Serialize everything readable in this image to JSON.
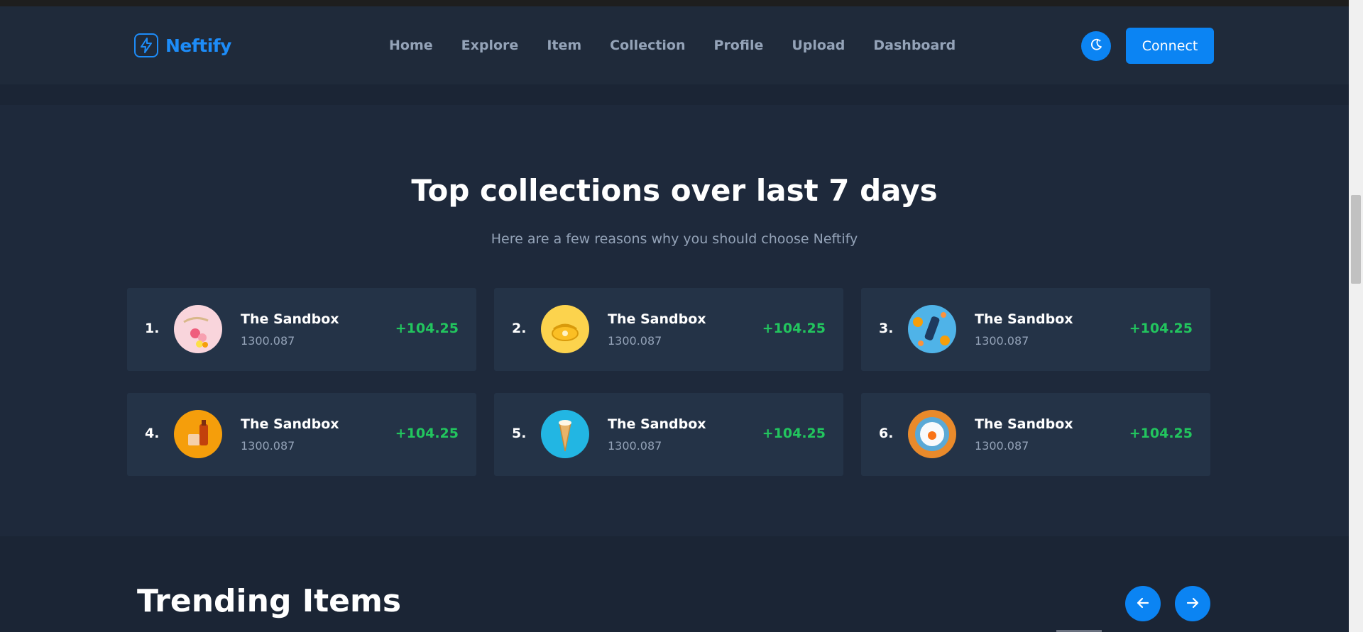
{
  "brand": {
    "name": "Neftify",
    "logo_icon": "bolt-icon",
    "accent": "#1d8cf8"
  },
  "nav": {
    "links": [
      "Home",
      "Explore",
      "Item",
      "Collection",
      "Profile",
      "Upload",
      "Dashboard"
    ]
  },
  "header": {
    "theme_icon": "moon-icon",
    "connect_label": "Connect"
  },
  "top_collections": {
    "title": "Top collections over last 7 days",
    "subtitle": "Here are a few reasons why you should choose Neftify",
    "items": [
      {
        "rank": "1.",
        "name": "The Sandbox",
        "amount": "1300.087",
        "change": "+104.25"
      },
      {
        "rank": "2.",
        "name": "The Sandbox",
        "amount": "1300.087",
        "change": "+104.25"
      },
      {
        "rank": "3.",
        "name": "The Sandbox",
        "amount": "1300.087",
        "change": "+104.25"
      },
      {
        "rank": "4.",
        "name": "The Sandbox",
        "amount": "1300.087",
        "change": "+104.25"
      },
      {
        "rank": "5.",
        "name": "The Sandbox",
        "amount": "1300.087",
        "change": "+104.25"
      },
      {
        "rank": "6.",
        "name": "The Sandbox",
        "amount": "1300.087",
        "change": "+104.25"
      }
    ]
  },
  "trending": {
    "title": "Trending Items",
    "prev_icon": "arrow-left-icon",
    "next_icon": "arrow-right-icon"
  },
  "colors": {
    "background": "#1e293b",
    "card": "#243347",
    "positive": "#22c55e",
    "button": "#0b84f3"
  }
}
